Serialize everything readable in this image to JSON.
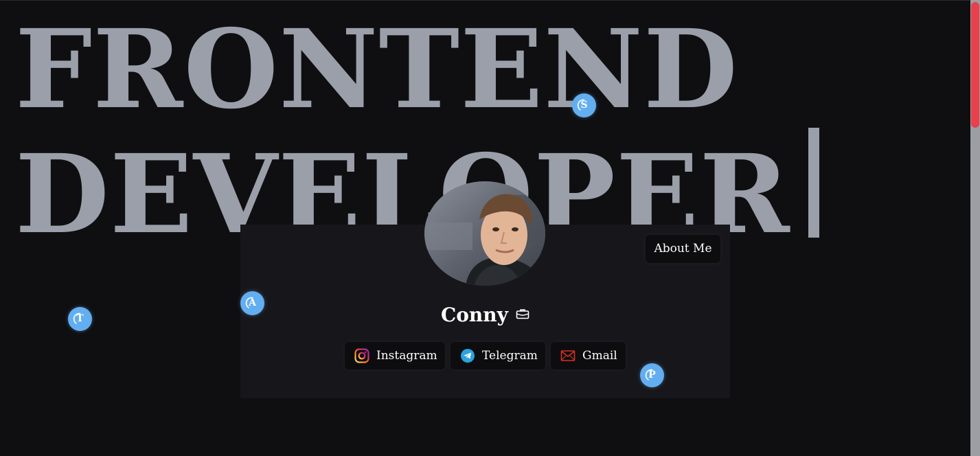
{
  "hero": {
    "line1": "FRONTEND",
    "line2": "DEVELOPER"
  },
  "profile": {
    "name": "Conny",
    "avatar_icon": "portrait-photo",
    "name_icon": "briefcase-icon",
    "about_label": "About Me"
  },
  "socials": [
    {
      "label": "Instagram",
      "icon": "instagram-icon"
    },
    {
      "label": "Telegram",
      "icon": "telegram-icon"
    },
    {
      "label": "Gmail",
      "icon": "gmail-icon"
    }
  ],
  "bubbles": {
    "s": "S",
    "a": "A",
    "t": "T",
    "p": "P"
  },
  "colors": {
    "background": "#0f0f11",
    "card": "#17171b",
    "hero_text": "#9a9fa9",
    "bubble": "#62aef0",
    "scroll_thumb": "#e8404c"
  }
}
